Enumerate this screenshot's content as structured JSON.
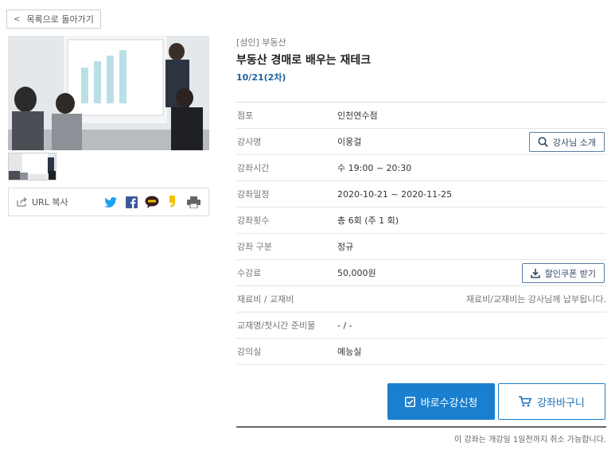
{
  "nav": {
    "back_label": "목록으로 돌아가기"
  },
  "share": {
    "url_copy_label": "URL 복사",
    "icons": [
      "twitter-icon",
      "facebook-icon",
      "kakaotalk-icon",
      "kakaostory-icon",
      "print-icon"
    ],
    "colors": {
      "twitter": "#1da1f2",
      "facebook": "#3b5998",
      "kakaotalk": "#3a1d1d",
      "kakaostory": "#f2c200",
      "print": "#666666"
    }
  },
  "course": {
    "category": "[성인] 부동산",
    "title": "부동산 경매로 배우는 재테크",
    "session": "10/21(2차)"
  },
  "info_rows": [
    {
      "label": "점포",
      "value": "인천연수점"
    },
    {
      "label": "강사명",
      "value": "이웅걸",
      "button": "강사님 소개"
    },
    {
      "label": "강좌시간",
      "value": "수 19:00 ~ 20:30"
    },
    {
      "label": "강좌일정",
      "value": "2020-10-21 ~ 2020-11-25"
    },
    {
      "label": "강좌횟수",
      "value": "총 6회 (주 1 회)"
    },
    {
      "label": "강좌 구분",
      "value": "정규"
    },
    {
      "label": "수강료",
      "value": "50,000원",
      "button": "할인쿠폰 받기"
    },
    {
      "label": "재료비 / 교재비",
      "value": "",
      "note": "재료비/교재비는 강사님께 납부됩니다."
    },
    {
      "label": "교재명/첫시간 준비물",
      "value": "- / -"
    },
    {
      "label": "강의실",
      "value": "예능실"
    }
  ],
  "actions": {
    "apply_label": "바로수강신청",
    "cart_label": "강좌바구니"
  },
  "notice": "이 강좌는 개강일 1일전까지 취소 가능합니다.",
  "colors": {
    "primary": "#1a7fcf",
    "session_text": "#1f5f9e"
  }
}
